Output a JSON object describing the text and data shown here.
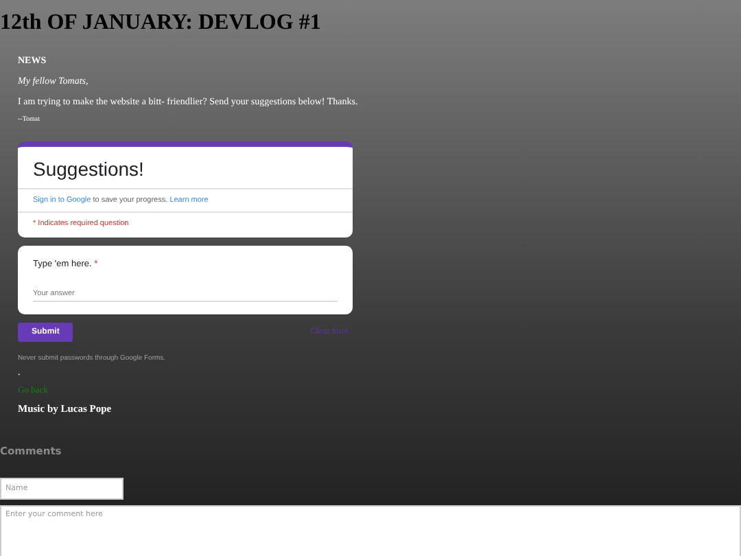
{
  "title": "12th OF JANUARY: DEVLOG #1",
  "post": {
    "section": "NEWS",
    "greeting": "My fellow Tomats,",
    "body": "I am trying to make the website a bitt- friendlier? Send your suggestions below! Thanks.",
    "signature": "--Tomat"
  },
  "form": {
    "title": "Suggestions!",
    "sign_in_link": "Sign in to Google",
    "sign_in_text": "to save your progress.",
    "learn_more": "Learn more",
    "required_note": "* Indicates required question",
    "question": {
      "label": "Type 'em here.",
      "required_mark": "*",
      "placeholder": "Your answer"
    },
    "submit": "Submit",
    "clear": "Clear form",
    "warning": "Never submit passwords through Google Forms."
  },
  "dot": ".",
  "back_link": "Go back",
  "credit": "Music by Lucas Pope",
  "comments": {
    "heading": "Comments",
    "name_placeholder": "Name",
    "comment_placeholder": "Enter your comment here"
  }
}
